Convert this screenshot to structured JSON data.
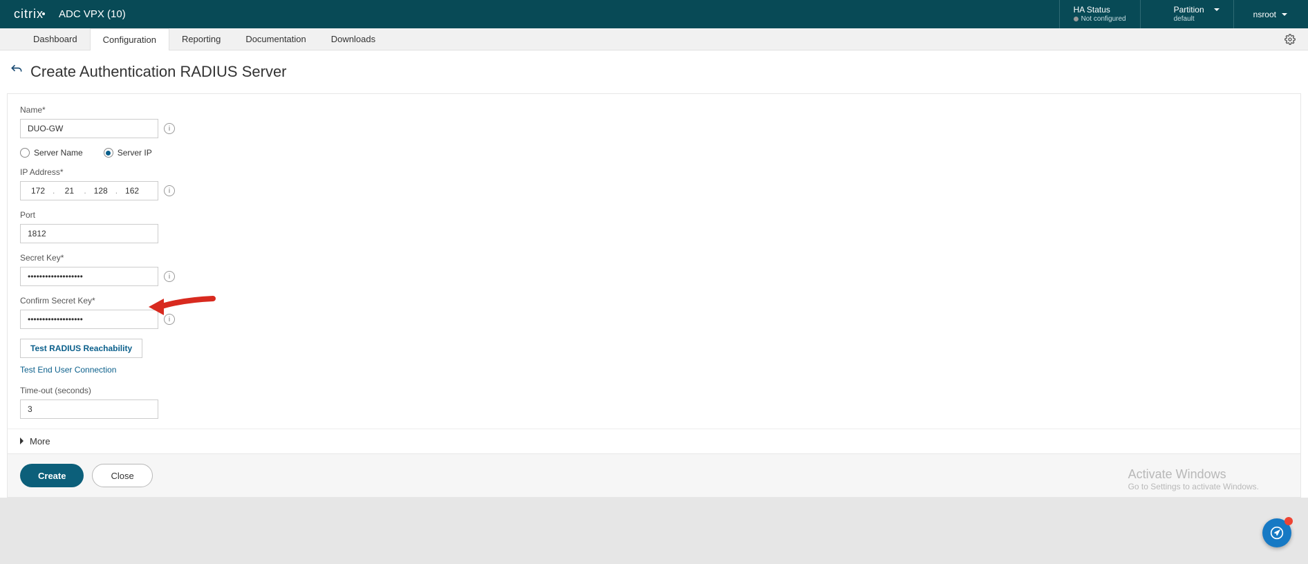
{
  "header": {
    "brand": "citrix",
    "product": "ADC VPX (10)",
    "ha_status_label": "HA Status",
    "ha_status_value": "Not configured",
    "partition_label": "Partition",
    "partition_value": "default",
    "user": "nsroot"
  },
  "nav": {
    "tabs": [
      "Dashboard",
      "Configuration",
      "Reporting",
      "Documentation",
      "Downloads"
    ],
    "active": "Configuration"
  },
  "page": {
    "title": "Create Authentication RADIUS Server"
  },
  "form": {
    "name_label": "Name*",
    "name_value": "DUO-GW",
    "radio_server_name": "Server Name",
    "radio_server_ip": "Server IP",
    "ip_address_label": "IP Address*",
    "ip_octets": [
      "172",
      "21",
      "128",
      "162"
    ],
    "port_label": "Port",
    "port_value": "1812",
    "secret_key_label": "Secret Key*",
    "secret_key_value": "•••••••••••••••••••",
    "confirm_secret_key_label": "Confirm Secret Key*",
    "confirm_secret_key_value": "•••••••••••••••••••",
    "test_reachability_label": "Test RADIUS Reachability",
    "test_end_user_label": "Test End User Connection",
    "timeout_label": "Time-out (seconds)",
    "timeout_value": "3",
    "more_label": "More"
  },
  "footer": {
    "create_label": "Create",
    "close_label": "Close"
  },
  "watermark": {
    "line1": "Activate Windows",
    "line2": "Go to Settings to activate Windows."
  }
}
